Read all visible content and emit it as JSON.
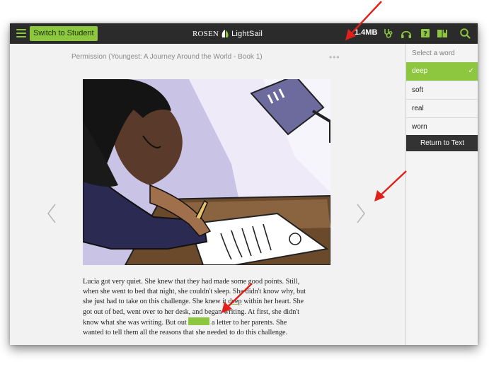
{
  "toolbar": {
    "switch_label": "Switch to Student",
    "brand_rosen": "ROSEN",
    "brand_lightsail": "LightSail",
    "size_label": "1.4MB"
  },
  "book": {
    "title": "Permission (Youngest: A Journey Around the World - Book 1)",
    "more_label": "•••"
  },
  "passage": {
    "line1": "Lucia got very quiet. She knew that they had made some good points. Still,",
    "line2": "when she went to bed that night, she couldn't sleep. She didn't know why, but",
    "line3a": "she just had to take on this challenge. She knew it ",
    "line3_word": "deep",
    "line3b": " within her heart. She",
    "line4": "got out of bed, went over to her desk, and began writing. At first, she didn't",
    "line5a": "know what she was writing. But out ",
    "line5b": " a letter to her parents. She",
    "line6": "wanted to tell them all the reasons that she needed to do this challenge."
  },
  "word_panel": {
    "header": "Select a word",
    "words": [
      {
        "label": "deep",
        "selected": true
      },
      {
        "label": "soft",
        "selected": false
      },
      {
        "label": "real",
        "selected": false
      },
      {
        "label": "worn",
        "selected": false
      }
    ],
    "check": "✓",
    "return_label": "Return to Text"
  },
  "icons": {
    "menu": "hamburger-menu-icon",
    "stethoscope": "stethoscope-icon",
    "headphones": "headphones-icon",
    "quiz": "quiz-icon",
    "book": "book-icon",
    "search": "search-icon",
    "prev": "chevron-left-icon",
    "next": "chevron-right-icon"
  },
  "colors": {
    "accent_green": "#8dc63f",
    "topbar": "#2b2b2b",
    "annotation_red": "#e0211b",
    "illustration_lavender": "#c9c3e6"
  }
}
